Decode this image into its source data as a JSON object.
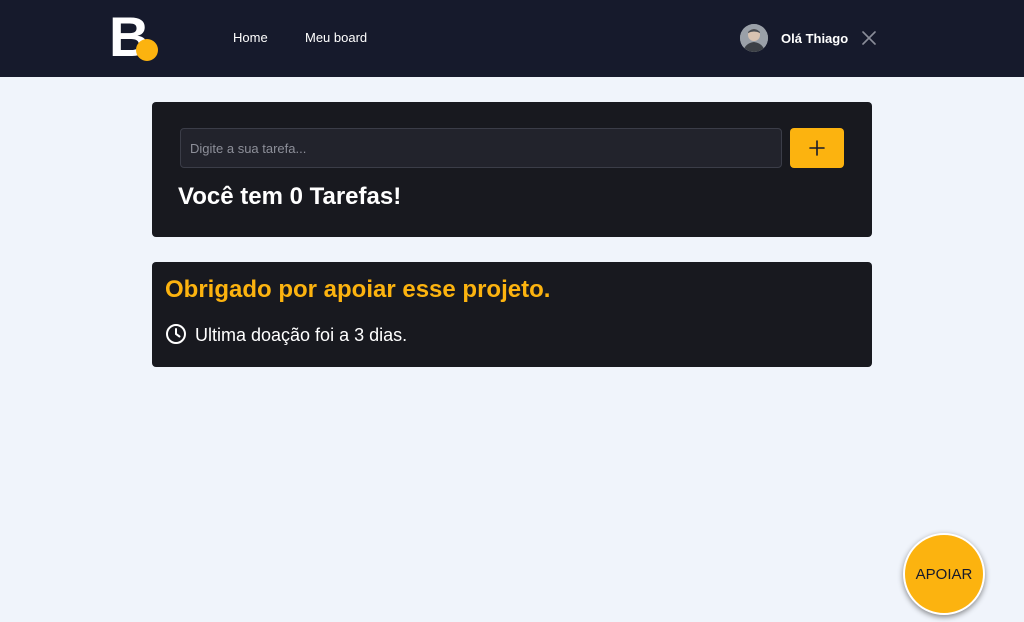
{
  "header": {
    "logo_letter": "B",
    "nav": {
      "home": "Home",
      "board": "Meu board"
    },
    "user": {
      "greeting": "Olá Thiago"
    }
  },
  "tasks": {
    "input_placeholder": "Digite a sua tarefa...",
    "input_value": "",
    "add_label": "+",
    "count_text": "Você tem 0 Tarefas!"
  },
  "support": {
    "thanks_text": "Obrigado por apoiar esse projeto.",
    "last_donation_text": "Ultima doação foi a 3 dias."
  },
  "floating_button": {
    "label": "APOIAR"
  },
  "colors": {
    "header_bg": "#161a2c",
    "page_bg": "#f0f4fb",
    "card_bg": "#18191f",
    "accent": "#fcb30f",
    "text_light": "#ffffff"
  },
  "icons": {
    "logo_dot": "circle",
    "add": "plus-icon",
    "close": "close-icon",
    "clock": "clock-icon"
  }
}
